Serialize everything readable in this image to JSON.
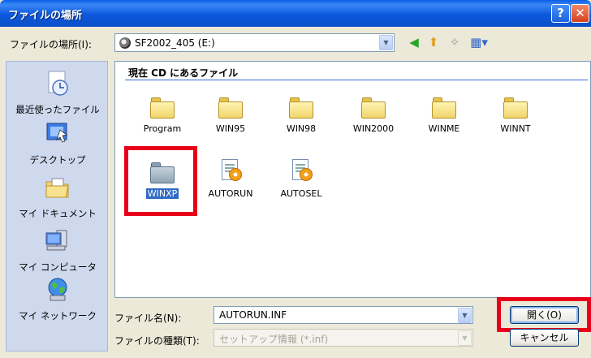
{
  "title": "ファイルの場所",
  "location": {
    "label": "ファイルの場所(I):",
    "value": "SF2002_405 (E:)"
  },
  "toolbar": {
    "back_icon": "back-arrow-icon",
    "up_icon": "folder-up-icon",
    "new_folder_icon": "new-folder-icon",
    "view_menu_icon": "view-menu-icon"
  },
  "places": [
    {
      "label": "最近使ったファイル",
      "icon": "recent-files-icon"
    },
    {
      "label": "デスクトップ",
      "icon": "desktop-icon"
    },
    {
      "label": "マイ ドキュメント",
      "icon": "my-documents-icon"
    },
    {
      "label": "マイ コンピュータ",
      "icon": "my-computer-icon"
    },
    {
      "label": "マイ ネットワーク",
      "icon": "my-network-icon"
    }
  ],
  "filelist": {
    "group_header": "現在 CD にあるファイル",
    "items": [
      {
        "name": "Program",
        "type": "folder"
      },
      {
        "name": "WIN95",
        "type": "folder"
      },
      {
        "name": "WIN98",
        "type": "folder"
      },
      {
        "name": "WIN2000",
        "type": "folder"
      },
      {
        "name": "WINME",
        "type": "folder"
      },
      {
        "name": "WINNT",
        "type": "folder"
      },
      {
        "name": "WINXP",
        "type": "folder",
        "selected": true
      },
      {
        "name": "AUTORUN",
        "type": "setup-info"
      },
      {
        "name": "AUTOSEL",
        "type": "setup-info"
      }
    ]
  },
  "filename": {
    "label": "ファイル名(N):",
    "value": "AUTORUN.INF"
  },
  "filetype": {
    "label": "ファイルの種類(T):",
    "value": "セットアップ情報 (*.inf)"
  },
  "buttons": {
    "open": "開く(O)",
    "cancel": "キャンセル",
    "help": "?",
    "close": "✕"
  },
  "colors": {
    "titlebar": "#0a5fe6",
    "highlight": "#e8001a",
    "selection": "#316ac5"
  }
}
